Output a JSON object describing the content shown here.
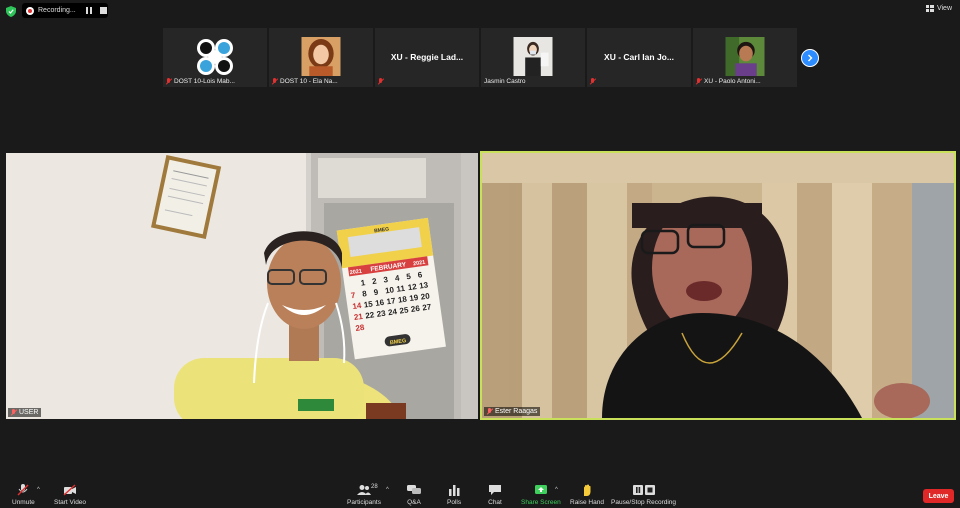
{
  "recording": {
    "label": "Recording..."
  },
  "view_label": "View",
  "participants_strip": [
    {
      "name": "DOST 10-Lois Mab...",
      "muted": true,
      "type": "logo"
    },
    {
      "name": "DOST 10 - Ela Na...",
      "muted": true,
      "type": "photo"
    },
    {
      "name": "",
      "display": "XU - Reggie Lad...",
      "muted": true,
      "type": "text"
    },
    {
      "name": "Jasmin Castro",
      "muted": false,
      "type": "photo"
    },
    {
      "name": "",
      "display": "XU - Carl Ian Jo...",
      "muted": true,
      "type": "text"
    },
    {
      "name": "XU - Paolo Antoni...",
      "muted": true,
      "type": "photo"
    }
  ],
  "main_videos": {
    "left_name": "USER",
    "right_name": "Ester Raagas",
    "calendar": {
      "brand_top": "BMEG",
      "year_left": "2021",
      "month": "FEBRUARY",
      "year_right": "2021",
      "rows": [
        [
          "",
          "1",
          "2",
          "3",
          "4",
          "5",
          "6"
        ],
        [
          "7",
          "8",
          "9",
          "10",
          "11",
          "12",
          "13"
        ],
        [
          "14",
          "15",
          "16",
          "17",
          "18",
          "19",
          "20"
        ],
        [
          "21",
          "22",
          "23",
          "24",
          "25",
          "26",
          "27"
        ],
        [
          "28",
          "",
          "",
          "",
          "",
          "",
          ""
        ]
      ],
      "brand_bottom": "BMEG"
    }
  },
  "toolbar": {
    "unmute": "Unmute",
    "start_video": "Start Video",
    "participants": "Participants",
    "participants_count": "28",
    "qa": "Q&A",
    "polls": "Polls",
    "chat": "Chat",
    "share_screen": "Share Screen",
    "raise_hand": "Raise Hand",
    "pause_stop": "Pause/Stop Recording",
    "leave": "Leave"
  },
  "colors": {
    "active_speaker_border": "#c8e05a",
    "share_green": "#3ecf5c",
    "leave_red": "#e02828",
    "accent_blue": "#2d8cff"
  }
}
